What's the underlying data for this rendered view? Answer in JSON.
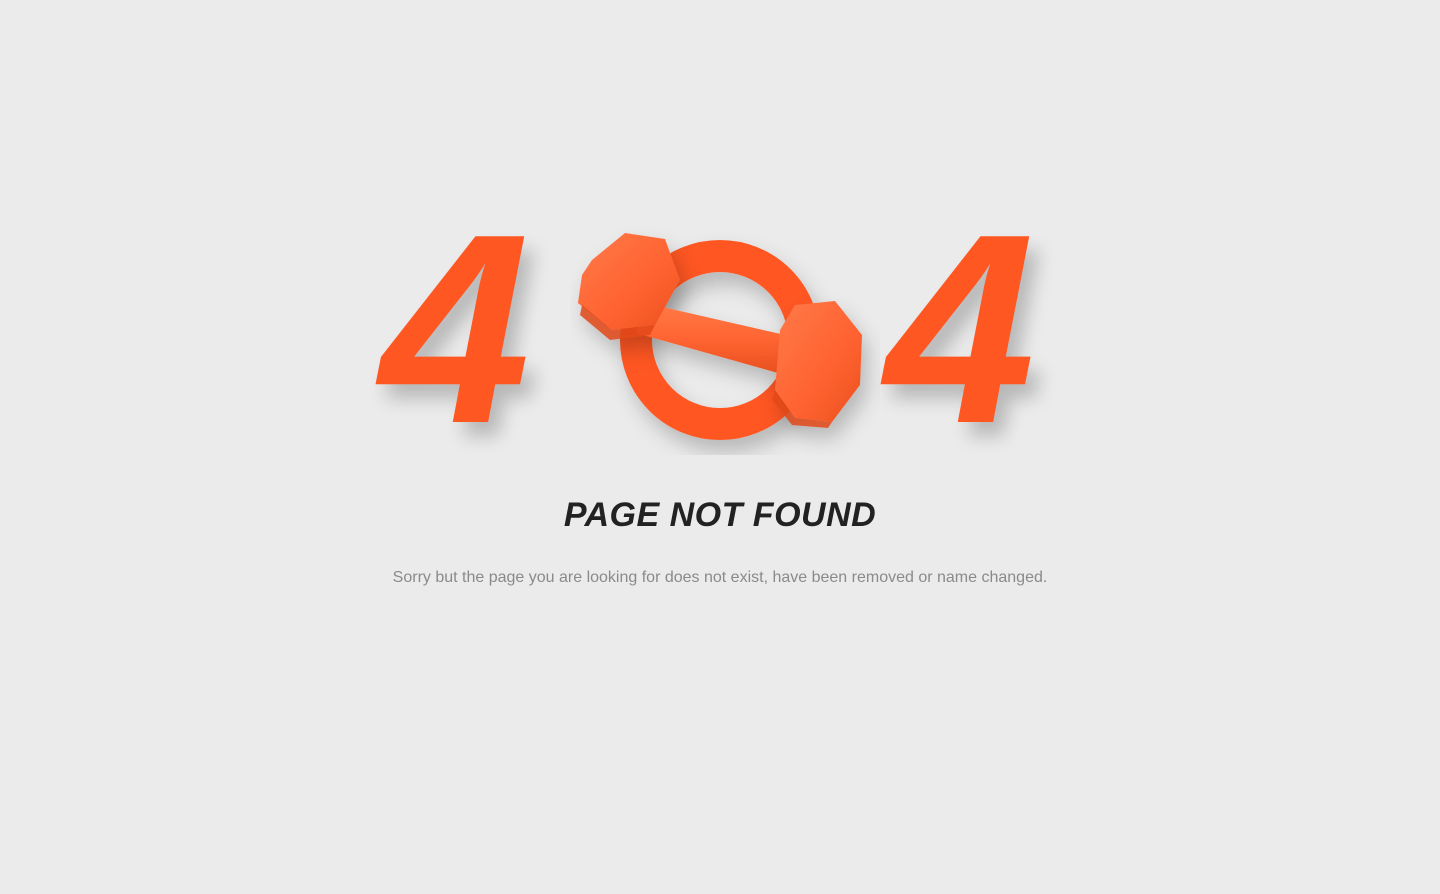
{
  "error": {
    "digit_left": "4",
    "digit_right": "4",
    "middle_graphic": "dumbbell-in-ring-icon",
    "title": "PAGE NOT FOUND",
    "message": "Sorry but the page you are looking for does not exist, have been removed or name changed."
  },
  "colors": {
    "background": "#ebebeb",
    "accent": "#ff5722",
    "title": "#222222",
    "message": "#8a8a8a"
  }
}
